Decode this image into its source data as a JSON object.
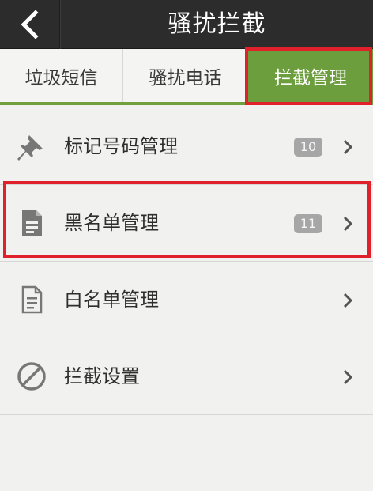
{
  "header": {
    "title": "骚扰拦截",
    "back_icon": "chevron-left-icon"
  },
  "tabs": [
    {
      "label": "垃圾短信",
      "selected": false
    },
    {
      "label": "骚扰电话",
      "selected": false
    },
    {
      "label": "拦截管理",
      "selected": true
    }
  ],
  "list": {
    "items": [
      {
        "label": "标记号码管理",
        "badge": "10",
        "icon": "pushpin-icon"
      },
      {
        "label": "黑名单管理",
        "badge": "11",
        "icon": "document-filled-icon"
      },
      {
        "label": "白名单管理",
        "badge": "",
        "icon": "document-outline-icon"
      },
      {
        "label": "拦截设置",
        "badge": "",
        "icon": "block-icon"
      }
    ]
  },
  "colors": {
    "header_bg": "#2c2c2c",
    "accent_green": "#6c9e3d",
    "highlight_red": "#e0202a",
    "badge_gray": "#a6a6a6"
  }
}
